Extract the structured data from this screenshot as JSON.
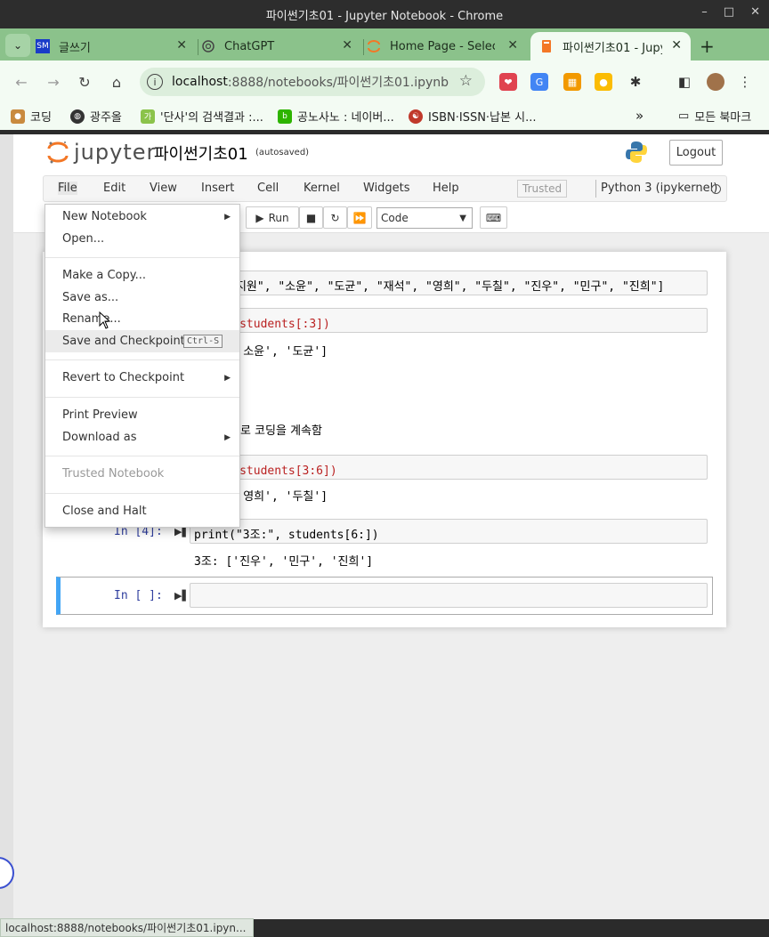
{
  "window": {
    "title": "파이썬기초01 - Jupyter Notebook - Chrome",
    "minimize": "–",
    "maximize": "□",
    "close": "✕"
  },
  "tabs": [
    {
      "label": "글쓰기",
      "favicon": "SM"
    },
    {
      "label": "ChatGPT",
      "favicon": "chatgpt-icon"
    },
    {
      "label": "Home Page - Select",
      "favicon": "jupyter-icon"
    },
    {
      "label": "파이썬기초01 - Jupyt",
      "favicon": "notebook-icon",
      "active": true
    }
  ],
  "tab_menu_glyph": "⌄",
  "new_tab": "+",
  "omnibox": {
    "host": "localhost",
    "path": ":8888/notebooks/파이썬기초01.ipynb"
  },
  "bookmarks": [
    {
      "label": "코딩"
    },
    {
      "label": "광주올"
    },
    {
      "label": "'단사'의 검색결과 :..."
    },
    {
      "label": "공노사노 : 네이버..."
    },
    {
      "label": "ISBN·ISSN·납본 시..."
    }
  ],
  "bookmarks_more": "»",
  "bookmarks_folder": "모든 북마크",
  "jupyter": {
    "logo_text": "jupyter",
    "notebook_name": "파이썬기초01",
    "autosaved": "(autosaved)",
    "logout": "Logout",
    "menus": [
      "File",
      "Edit",
      "View",
      "Insert",
      "Cell",
      "Kernel",
      "Widgets",
      "Help"
    ],
    "trusted": "Trusted",
    "kernel": "Python 3 (ipykernel)",
    "run_label": "Run",
    "cell_type": "Code"
  },
  "file_menu": {
    "items": [
      {
        "label": "New Notebook",
        "submenu": true
      },
      {
        "label": "Open..."
      },
      {
        "label": "Make a Copy..."
      },
      {
        "label": "Save as..."
      },
      {
        "label": "Rename..."
      },
      {
        "label": "Save and Checkpoint",
        "shortcut": "Ctrl-S"
      },
      {
        "label": "Revert to Checkpoint",
        "submenu": true
      },
      {
        "label": "Print Preview"
      },
      {
        "label": "Download as",
        "submenu": true
      },
      {
        "label": "Trusted Notebook",
        "disabled": true
      },
      {
        "label": "Close and Halt"
      }
    ]
  },
  "cells": {
    "cell1_code_visible": "s = [\"지원\", \"소윤\", \"도균\", \"재석\", \"영희\", \"두칠\", \"진우\", \"민구\", \"진희\"]",
    "cell2_code_visible": "1조:\", students[:3])",
    "cell2_output_visible": "지원', '소윤', '도균']",
    "markdown_visible": "지로 코딩을 계속함",
    "cell3_code_visible": "2조:\", students[3:6])",
    "cell3_output_visible": "재석', '영희', '두칠']",
    "cell4_prompt": "In [4]:",
    "cell4_code": "print(\"3조:\", students[6:])",
    "cell4_output": "3조: ['진우', '민구', '진희']",
    "cell5_prompt": "In [ ]:"
  },
  "status_bar": "localhost:8888/notebooks/파이썬기초01.ipyn..."
}
